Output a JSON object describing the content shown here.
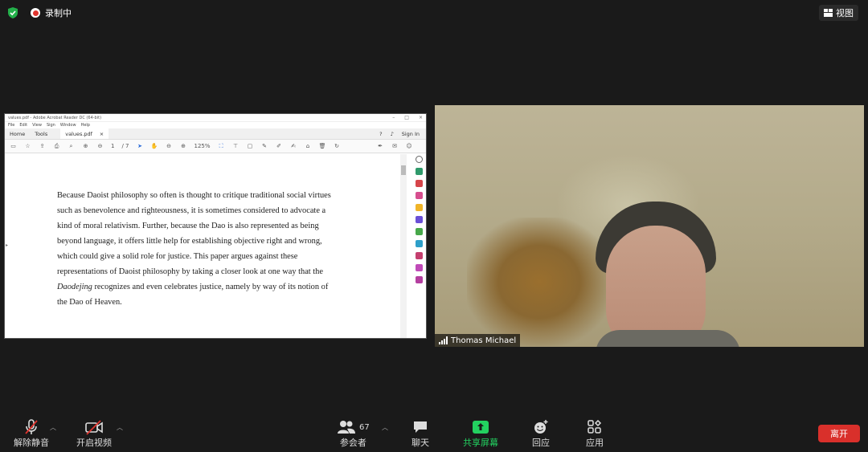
{
  "topbar": {
    "recording_label": "录制中",
    "view_label": "视图"
  },
  "shared_screen": {
    "window_title": "values.pdf - Adobe Acrobat Reader DC (64-bit)",
    "menu_items": [
      "File",
      "Edit",
      "View",
      "Sign",
      "Window",
      "Help"
    ],
    "tabs": {
      "home": "Home",
      "tools": "Tools",
      "doc": "values.pdf",
      "close": "×"
    },
    "sign_in": "Sign In",
    "page_current": "1",
    "page_total": "/ 7",
    "zoom": "125%",
    "paragraph_lines": [
      "Because Daoist philosophy so often is thought to critique traditional social virtues",
      "such as benevolence and righteousness, it is sometimes considered to advocate a",
      "kind of moral relativism. Further, because the Dao is also represented as being",
      "beyond language, it offers little help for establishing objective right and wrong,",
      "which could give a solid role for justice. This paper argues against these",
      "representations of Daoist philosophy by taking a closer look at one way that the"
    ],
    "line7_italic": "Daodejing",
    "line7_rest": " recognizes and even celebrates justice, namely by way of its notion of",
    "line8": "the Dao of Heaven."
  },
  "video": {
    "participant_name": "Thomas Michael"
  },
  "bottombar": {
    "unmute": "解除静音",
    "start_video": "开启视频",
    "participants": "参会者",
    "participant_count": "67",
    "chat": "聊天",
    "share_screen": "共享屏幕",
    "reactions": "回应",
    "apps": "应用",
    "leave": "离开"
  },
  "colors": {
    "share_green": "#23d160",
    "leave_red": "#d9302b",
    "background": "#1a1a1a"
  }
}
